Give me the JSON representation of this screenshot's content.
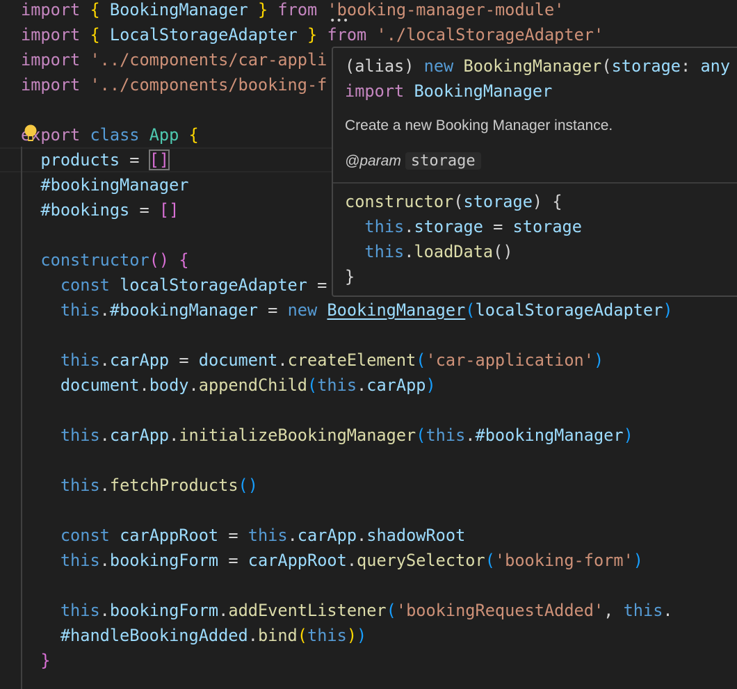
{
  "code": {
    "lines": [
      {
        "tokens": [
          [
            "import",
            "kw"
          ],
          [
            " ",
            "p"
          ],
          [
            "{",
            "b1"
          ],
          [
            " ",
            "p"
          ],
          [
            "BookingManager",
            "va"
          ],
          [
            " ",
            "p"
          ],
          [
            "}",
            "b1"
          ],
          [
            " ",
            "p"
          ],
          [
            "from",
            "kw"
          ],
          [
            " ",
            "p"
          ],
          [
            "'booking-manager-module'",
            "s"
          ]
        ]
      },
      {
        "tokens": [
          [
            "import",
            "kw"
          ],
          [
            " ",
            "p"
          ],
          [
            "{",
            "b1"
          ],
          [
            " ",
            "p"
          ],
          [
            "LocalStorageAdapter",
            "va"
          ],
          [
            " ",
            "p"
          ],
          [
            "}",
            "b1"
          ],
          [
            " ",
            "p"
          ],
          [
            "from",
            "kw"
          ],
          [
            " ",
            "p"
          ],
          [
            "'./localStorageAdapter'",
            "s"
          ]
        ]
      },
      {
        "tokens": [
          [
            "import",
            "kw"
          ],
          [
            " ",
            "p"
          ],
          [
            "'../components/car-appli",
            "s"
          ]
        ]
      },
      {
        "tokens": [
          [
            "import",
            "kw"
          ],
          [
            " ",
            "p"
          ],
          [
            "'../components/booking-f",
            "s"
          ]
        ]
      },
      {
        "tokens": []
      },
      {
        "tokens": [
          [
            "export",
            "kw"
          ],
          [
            " ",
            "p"
          ],
          [
            "class",
            "st"
          ],
          [
            " ",
            "p"
          ],
          [
            "App",
            "cl"
          ],
          [
            " ",
            "p"
          ],
          [
            "{",
            "b1"
          ]
        ]
      },
      {
        "tokens": [
          [
            "  ",
            "p"
          ],
          [
            "products",
            "va"
          ],
          [
            " = ",
            "p"
          ],
          [
            "[]",
            "b2 boxed"
          ]
        ]
      },
      {
        "tokens": [
          [
            "  ",
            "p"
          ],
          [
            "#bookingManager",
            "va"
          ]
        ]
      },
      {
        "tokens": [
          [
            "  ",
            "p"
          ],
          [
            "#bookings",
            "va"
          ],
          [
            " = ",
            "p"
          ],
          [
            "[]",
            "b2"
          ]
        ]
      },
      {
        "tokens": []
      },
      {
        "tokens": [
          [
            "  ",
            "p"
          ],
          [
            "constructor",
            "st"
          ],
          [
            "()",
            "b2"
          ],
          [
            " ",
            "p"
          ],
          [
            "{",
            "b2"
          ]
        ]
      },
      {
        "tokens": [
          [
            "    ",
            "p"
          ],
          [
            "const",
            "st"
          ],
          [
            " ",
            "p"
          ],
          [
            "localStorageAdapter",
            "va"
          ],
          [
            " =",
            "p"
          ]
        ]
      },
      {
        "tokens": [
          [
            "    ",
            "p"
          ],
          [
            "this",
            "st"
          ],
          [
            ".",
            "p"
          ],
          [
            "#bookingManager",
            "va"
          ],
          [
            " = ",
            "p"
          ],
          [
            "new",
            "st"
          ],
          [
            " ",
            "p"
          ],
          [
            "BookingManager",
            "va ul"
          ],
          [
            "(",
            "b3"
          ],
          [
            "localStorageAdapter",
            "va"
          ],
          [
            ")",
            "b3"
          ]
        ]
      },
      {
        "tokens": []
      },
      {
        "tokens": [
          [
            "    ",
            "p"
          ],
          [
            "this",
            "st"
          ],
          [
            ".",
            "p"
          ],
          [
            "carApp",
            "va"
          ],
          [
            " = ",
            "p"
          ],
          [
            "document",
            "va"
          ],
          [
            ".",
            "p"
          ],
          [
            "createElement",
            "fn"
          ],
          [
            "(",
            "b3"
          ],
          [
            "'car-application'",
            "s"
          ],
          [
            ")",
            "b3"
          ]
        ]
      },
      {
        "tokens": [
          [
            "    ",
            "p"
          ],
          [
            "document",
            "va"
          ],
          [
            ".",
            "p"
          ],
          [
            "body",
            "va"
          ],
          [
            ".",
            "p"
          ],
          [
            "appendChild",
            "fn"
          ],
          [
            "(",
            "b3"
          ],
          [
            "this",
            "st"
          ],
          [
            ".",
            "p"
          ],
          [
            "carApp",
            "va"
          ],
          [
            ")",
            "b3"
          ]
        ]
      },
      {
        "tokens": []
      },
      {
        "tokens": [
          [
            "    ",
            "p"
          ],
          [
            "this",
            "st"
          ],
          [
            ".",
            "p"
          ],
          [
            "carApp",
            "va"
          ],
          [
            ".",
            "p"
          ],
          [
            "initializeBookingManager",
            "fn"
          ],
          [
            "(",
            "b3"
          ],
          [
            "this",
            "st"
          ],
          [
            ".",
            "p"
          ],
          [
            "#bookingManager",
            "va"
          ],
          [
            ")",
            "b3"
          ]
        ]
      },
      {
        "tokens": []
      },
      {
        "tokens": [
          [
            "    ",
            "p"
          ],
          [
            "this",
            "st"
          ],
          [
            ".",
            "p"
          ],
          [
            "fetchProducts",
            "fn"
          ],
          [
            "()",
            "b3"
          ]
        ]
      },
      {
        "tokens": []
      },
      {
        "tokens": [
          [
            "    ",
            "p"
          ],
          [
            "const",
            "st"
          ],
          [
            " ",
            "p"
          ],
          [
            "carAppRoot",
            "va"
          ],
          [
            " = ",
            "p"
          ],
          [
            "this",
            "st"
          ],
          [
            ".",
            "p"
          ],
          [
            "carApp",
            "va"
          ],
          [
            ".",
            "p"
          ],
          [
            "shadowRoot",
            "va"
          ]
        ]
      },
      {
        "tokens": [
          [
            "    ",
            "p"
          ],
          [
            "this",
            "st"
          ],
          [
            ".",
            "p"
          ],
          [
            "bookingForm",
            "va"
          ],
          [
            " = ",
            "p"
          ],
          [
            "carAppRoot",
            "va"
          ],
          [
            ".",
            "p"
          ],
          [
            "querySelector",
            "fn"
          ],
          [
            "(",
            "b3"
          ],
          [
            "'booking-form'",
            "s"
          ],
          [
            ")",
            "b3"
          ]
        ]
      },
      {
        "tokens": []
      },
      {
        "tokens": [
          [
            "    ",
            "p"
          ],
          [
            "this",
            "st"
          ],
          [
            ".",
            "p"
          ],
          [
            "bookingForm",
            "va"
          ],
          [
            ".",
            "p"
          ],
          [
            "addEventListener",
            "fn"
          ],
          [
            "(",
            "b3"
          ],
          [
            "'bookingRequestAdded'",
            "s"
          ],
          [
            ", ",
            "p"
          ],
          [
            "this",
            "st"
          ],
          [
            ".",
            "p"
          ]
        ]
      },
      {
        "tokens": [
          [
            "    ",
            "p"
          ],
          [
            "#handleBookingAdded",
            "va"
          ],
          [
            ".",
            "p"
          ],
          [
            "bind",
            "fn"
          ],
          [
            "(",
            "b1"
          ],
          [
            "this",
            "st"
          ],
          [
            ")",
            "b1"
          ],
          [
            ")",
            "b3"
          ]
        ]
      },
      {
        "tokens": [
          [
            "  ",
            "p"
          ],
          [
            "}",
            "b2"
          ]
        ]
      }
    ]
  },
  "hover": {
    "sig1": [
      [
        "(alias) ",
        "p"
      ],
      [
        "new",
        "st"
      ],
      [
        " ",
        "p"
      ],
      [
        "BookingManager",
        "fn"
      ],
      [
        "(",
        "p"
      ],
      [
        "storage",
        "va"
      ],
      [
        ": ",
        "p"
      ],
      [
        "any",
        "va"
      ]
    ],
    "sig2": [
      [
        "import",
        "kw"
      ],
      [
        " ",
        "p"
      ],
      [
        "BookingManager",
        "va"
      ]
    ],
    "doc": "Create a new Booking Manager instance.",
    "param_tag": "@param",
    "param_name": "storage",
    "code": [
      [
        [
          "constructor",
          "fn"
        ],
        [
          "(",
          "p"
        ],
        [
          "storage",
          "va"
        ],
        [
          ") {",
          "p"
        ]
      ],
      [
        [
          "  ",
          "p"
        ],
        [
          "this",
          "st"
        ],
        [
          ".",
          "p"
        ],
        [
          "storage",
          "va"
        ],
        [
          " = ",
          "p"
        ],
        [
          "storage",
          "va"
        ]
      ],
      [
        [
          "  ",
          "p"
        ],
        [
          "this",
          "st"
        ],
        [
          ".",
          "p"
        ],
        [
          "loadData",
          "fn"
        ],
        [
          "()",
          "p"
        ]
      ],
      [
        [
          "}",
          "p"
        ]
      ]
    ]
  },
  "icons": {
    "lightbulb": "lightbulb-icon",
    "more": "ellipsis-icon"
  }
}
